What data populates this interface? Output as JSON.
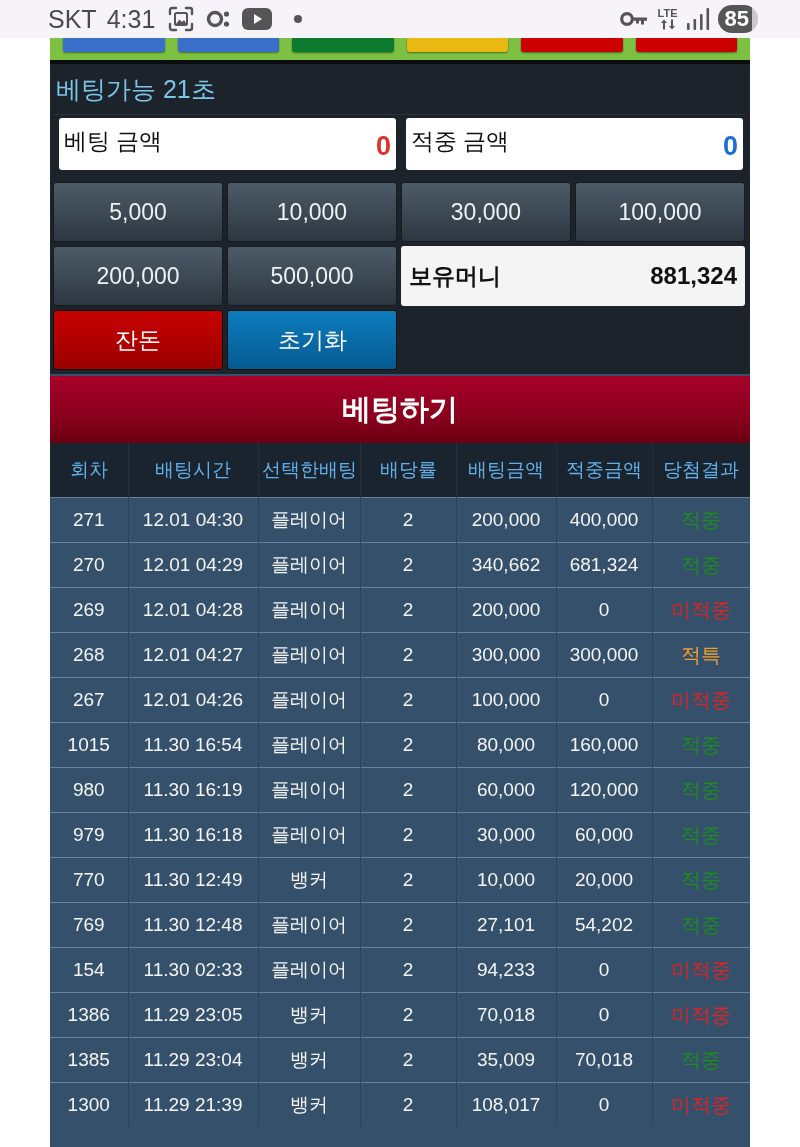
{
  "status_bar": {
    "carrier": "SKT",
    "time": "4:31",
    "network": "LTE",
    "battery": "85"
  },
  "strip": {
    "chips": [
      {
        "color": "#3a6fc9"
      },
      {
        "color": "#3a6fc9"
      },
      {
        "color": "#0c7a2f"
      },
      {
        "color": "#e9b812"
      },
      {
        "color": "#cc0000"
      },
      {
        "color": "#cc0000"
      }
    ]
  },
  "bet_panel": {
    "timer": "베팅가능 21초",
    "amount_displays": [
      {
        "label": "베팅 금액",
        "value": "0",
        "color": "#e0302a"
      },
      {
        "label": "적중 금액",
        "value": "0",
        "color": "#1a6fd6"
      }
    ],
    "amount_buttons": [
      "5,000",
      "10,000",
      "30,000",
      "100,000",
      "200,000",
      "500,000"
    ],
    "balance": {
      "label": "보유머니",
      "value": "881,324"
    },
    "actions": [
      {
        "label": "잔돈",
        "kind": "change"
      },
      {
        "label": "초기화",
        "kind": "reset"
      }
    ],
    "submit": "베팅하기"
  },
  "history": {
    "columns": [
      "회차",
      "배팅시간",
      "선택한배팅",
      "배당률",
      "배팅금액",
      "적중금액",
      "당첨결과"
    ],
    "rows": [
      {
        "round": "271",
        "time": "12.01 04:30",
        "pick": "플레이어",
        "odds": "2",
        "bet": "200,000",
        "payout": "400,000",
        "result": "적중",
        "color": "#1e8c1e"
      },
      {
        "round": "270",
        "time": "12.01 04:29",
        "pick": "플레이어",
        "odds": "2",
        "bet": "340,662",
        "payout": "681,324",
        "result": "적중",
        "color": "#1e8c1e"
      },
      {
        "round": "269",
        "time": "12.01 04:28",
        "pick": "플레이어",
        "odds": "2",
        "bet": "200,000",
        "payout": "0",
        "result": "미적중",
        "color": "#e02424"
      },
      {
        "round": "268",
        "time": "12.01 04:27",
        "pick": "플레이어",
        "odds": "2",
        "bet": "300,000",
        "payout": "300,000",
        "result": "적특",
        "color": "#f0a030"
      },
      {
        "round": "267",
        "time": "12.01 04:26",
        "pick": "플레이어",
        "odds": "2",
        "bet": "100,000",
        "payout": "0",
        "result": "미적중",
        "color": "#e02424"
      },
      {
        "round": "1015",
        "time": "11.30 16:54",
        "pick": "플레이어",
        "odds": "2",
        "bet": "80,000",
        "payout": "160,000",
        "result": "적중",
        "color": "#1e8c1e"
      },
      {
        "round": "980",
        "time": "11.30 16:19",
        "pick": "플레이어",
        "odds": "2",
        "bet": "60,000",
        "payout": "120,000",
        "result": "적중",
        "color": "#1e8c1e"
      },
      {
        "round": "979",
        "time": "11.30 16:18",
        "pick": "플레이어",
        "odds": "2",
        "bet": "30,000",
        "payout": "60,000",
        "result": "적중",
        "color": "#1e8c1e"
      },
      {
        "round": "770",
        "time": "11.30 12:49",
        "pick": "뱅커",
        "odds": "2",
        "bet": "10,000",
        "payout": "20,000",
        "result": "적중",
        "color": "#1e8c1e"
      },
      {
        "round": "769",
        "time": "11.30 12:48",
        "pick": "플레이어",
        "odds": "2",
        "bet": "27,101",
        "payout": "54,202",
        "result": "적중",
        "color": "#1e8c1e"
      },
      {
        "round": "154",
        "time": "11.30 02:33",
        "pick": "플레이어",
        "odds": "2",
        "bet": "94,233",
        "payout": "0",
        "result": "미적중",
        "color": "#e02424"
      },
      {
        "round": "1386",
        "time": "11.29 23:05",
        "pick": "뱅커",
        "odds": "2",
        "bet": "70,018",
        "payout": "0",
        "result": "미적중",
        "color": "#e02424"
      },
      {
        "round": "1385",
        "time": "11.29 23:04",
        "pick": "뱅커",
        "odds": "2",
        "bet": "35,009",
        "payout": "70,018",
        "result": "적중",
        "color": "#1e8c1e"
      },
      {
        "round": "1300",
        "time": "11.29 21:39",
        "pick": "뱅커",
        "odds": "2",
        "bet": "108,017",
        "payout": "0",
        "result": "미적중",
        "color": "#e02424"
      }
    ]
  }
}
